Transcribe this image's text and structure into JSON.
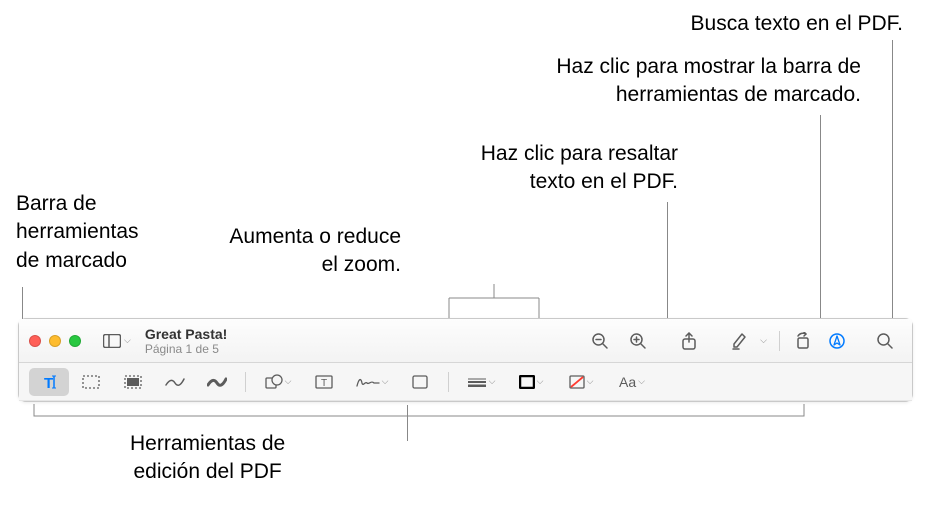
{
  "callouts": {
    "search": "Busca texto en el PDF.",
    "markup_toggle": "Haz clic para mostrar la barra de\nherramientas de marcado.",
    "highlight": "Haz clic para resaltar\ntexto en el PDF.",
    "zoom": "Aumenta o reduce\nel zoom.",
    "markup_bar": "Barra de\nherramientas\nde marcado",
    "edit_tools": "Herramientas de\nedición del PDF"
  },
  "document": {
    "title": "Great Pasta!",
    "page_status": "Página 1 de 5"
  },
  "toolbar": {
    "sidebar_label": "Sidebar",
    "zoom_out": "Zoom out",
    "zoom_in": "Zoom in",
    "share": "Share",
    "highlight": "Highlight",
    "rotate": "Rotate",
    "markup": "Markup",
    "search": "Search"
  },
  "markup": {
    "text": "Text",
    "select": "Rectangular Selection",
    "redact": "Redact",
    "sketch": "Sketch",
    "draw": "Draw",
    "shapes": "Shapes",
    "textbox": "Text Box",
    "sign": "Sign",
    "note": "Note",
    "style": "Shape Style",
    "border": "Border Color",
    "fill": "Fill Color",
    "font": "Text Style"
  },
  "colors": {
    "blue": "#007aff",
    "red": "#ff3b30",
    "icon": "#5c5c5c"
  }
}
